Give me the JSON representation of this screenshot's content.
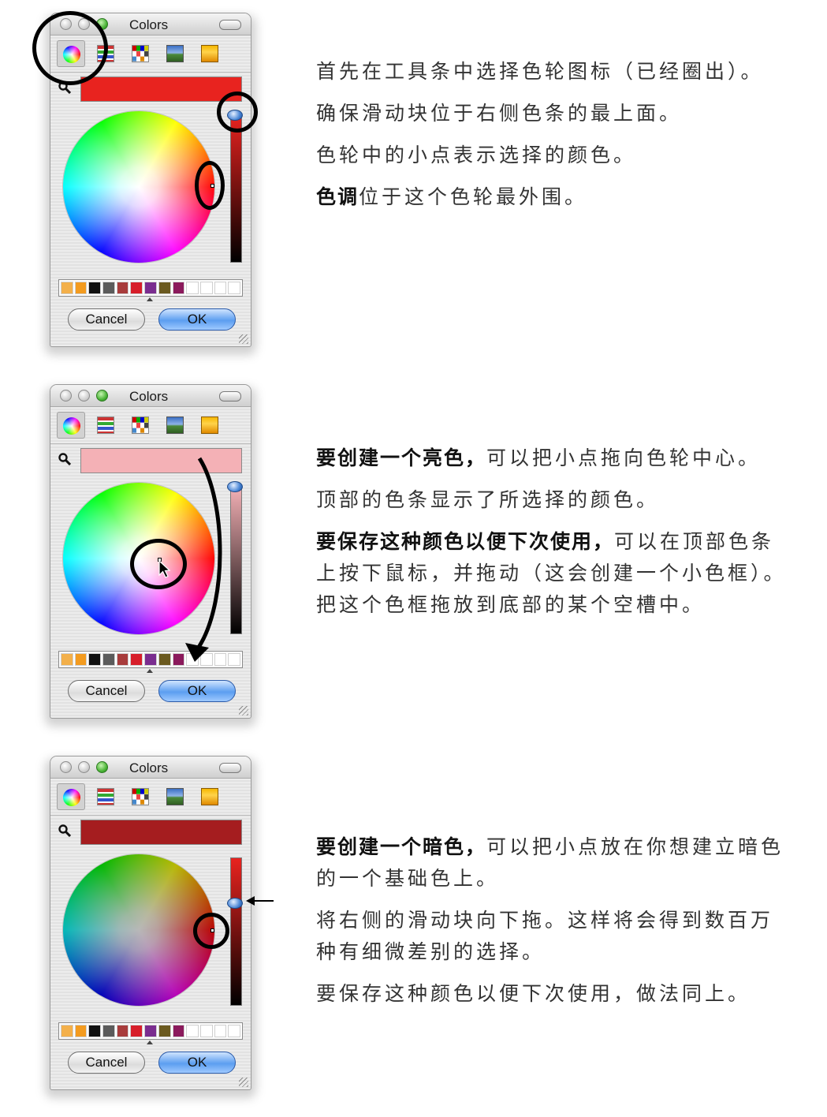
{
  "window": {
    "title": "Colors",
    "cancel_label": "Cancel",
    "ok_label": "OK",
    "toolbar_tools": [
      "color-wheel-icon",
      "color-sliders-icon",
      "color-palettes-icon",
      "image-palettes-icon",
      "crayons-icon"
    ]
  },
  "palette_colors": [
    "#f3b04b",
    "#f39b1f",
    "#111111",
    "#5b5b5b",
    "#a83c3c",
    "#d71e2a",
    "#7a2d8f",
    "#6b5a20",
    "#8b1a5c",
    "#ffffff",
    "#ffffff",
    "#ffffff",
    "#ffffff"
  ],
  "panels": [
    {
      "swatch_color": "#e8231f",
      "brightness_top": "#e8231f",
      "dimmed": false
    },
    {
      "swatch_color": "#f4b1b6",
      "brightness_top": "#f4b1b6",
      "dimmed": false
    },
    {
      "swatch_color": "#a51d1f",
      "brightness_top": "#e8231f",
      "dimmed": true
    }
  ],
  "section1": {
    "line1": "首先在工具条中选择色轮图标（已经圈出）。",
    "line2": "确保滑动块位于右侧色条的最上面。",
    "line3": "色轮中的小点表示选择的颜色。",
    "line4_bold": "色调",
    "line4_rest": "位于这个色轮最外围。"
  },
  "section2": {
    "line1_bold": "要创建一个亮色，",
    "line1_rest": "可以把小点拖向色轮中心。",
    "line2": "顶部的色条显示了所选择的颜色。",
    "line3_bold": "要保存这种颜色以便下次使用，",
    "line3_rest": "可以在顶部色条上按下鼠标，并拖动（这会创建一个小色框）。把这个色框拖放到底部的某个空槽中。"
  },
  "section3": {
    "line1_bold": "要创建一个暗色，",
    "line1_rest": "可以把小点放在你想建立暗色的一个基础色上。",
    "line2": "将右侧的滑动块向下拖。这样将会得到数百万种有细微差别的选择。",
    "line3": "要保存这种颜色以便下次使用，做法同上。"
  }
}
